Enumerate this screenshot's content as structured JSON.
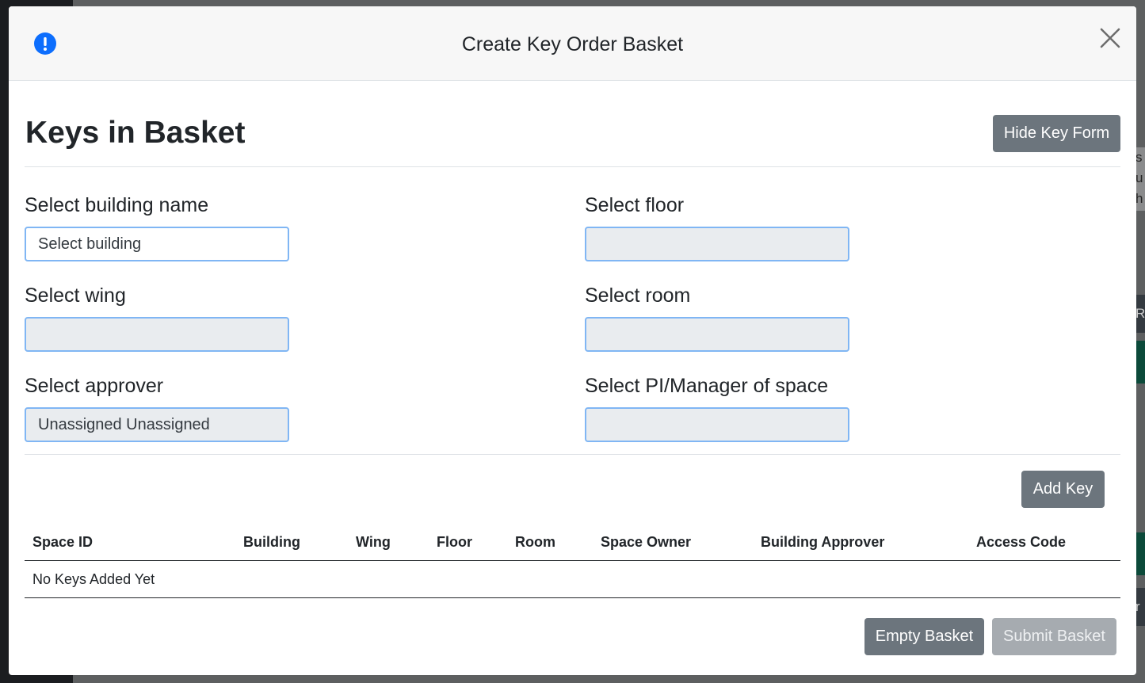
{
  "modal": {
    "title": "Create Key Order Basket"
  },
  "basket": {
    "heading": "Keys in Basket",
    "toggle_form_label": "Hide Key Form"
  },
  "form": {
    "building": {
      "label": "Select building name",
      "value": "Select building"
    },
    "floor": {
      "label": "Select floor",
      "value": ""
    },
    "wing": {
      "label": "Select wing",
      "value": ""
    },
    "room": {
      "label": "Select room",
      "value": ""
    },
    "approver": {
      "label": "Select approver",
      "value": "Unassigned Unassigned"
    },
    "manager": {
      "label": "Select PI/Manager of space",
      "value": ""
    },
    "add_key_label": "Add Key"
  },
  "table": {
    "columns": [
      "Space ID",
      "Building",
      "Wing",
      "Floor",
      "Room",
      "Space Owner",
      "Building Approver",
      "Access Code"
    ],
    "empty_message": "No Keys Added Yet"
  },
  "footer": {
    "empty_label": "Empty Basket",
    "submit_label": "Submit Basket"
  },
  "background": {
    "fragments": [
      "s",
      "u",
      "h",
      "R",
      "r"
    ]
  },
  "colors": {
    "accent": "#0d6efd",
    "secondary_button": "#6c757d",
    "input_focus_border": "#80b6f4",
    "disabled_input": "#e9ecef"
  },
  "icons": {
    "header_status": "alert-circle-icon",
    "close": "close-icon"
  }
}
